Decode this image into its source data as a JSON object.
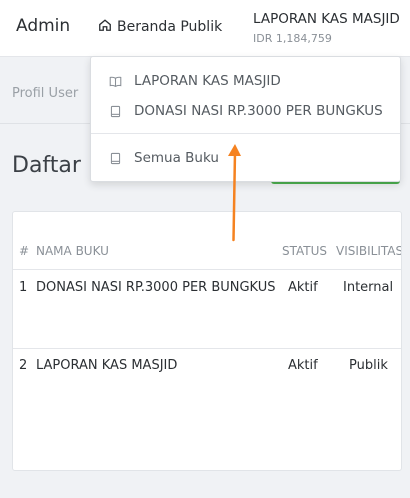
{
  "navbar": {
    "brand": "Admin",
    "public_link": "Beranda Publik",
    "book_title": "LAPORAN KAS MASJID",
    "book_balance": "IDR 1,184,759"
  },
  "subbar": {
    "profile_link": "Profil User"
  },
  "content": {
    "title": "Daftar Buku"
  },
  "table": {
    "headers": [
      "#",
      "NAMA BUKU",
      "STATUS",
      "VISIBILITAS"
    ],
    "rows": [
      {
        "no": "1",
        "name": "DONASI NASI RP.3000 PER BUNGKUS",
        "status": "Aktif",
        "visibility": "Internal"
      },
      {
        "no": "2",
        "name": "LAPORAN KAS MASJID",
        "status": "Aktif",
        "visibility": "Publik"
      }
    ]
  },
  "dropdown": {
    "items": [
      {
        "label": "LAPORAN KAS MASJID",
        "icon": "open-book-icon"
      },
      {
        "label": "DONASI NASI RP.3000 PER BUNGKUS",
        "icon": "book-icon"
      }
    ],
    "all_books": {
      "label": "Semua Buku",
      "icon": "book-icon"
    }
  },
  "colors": {
    "accent_green": "#4caf50",
    "annotation_arrow": "#f58220"
  }
}
